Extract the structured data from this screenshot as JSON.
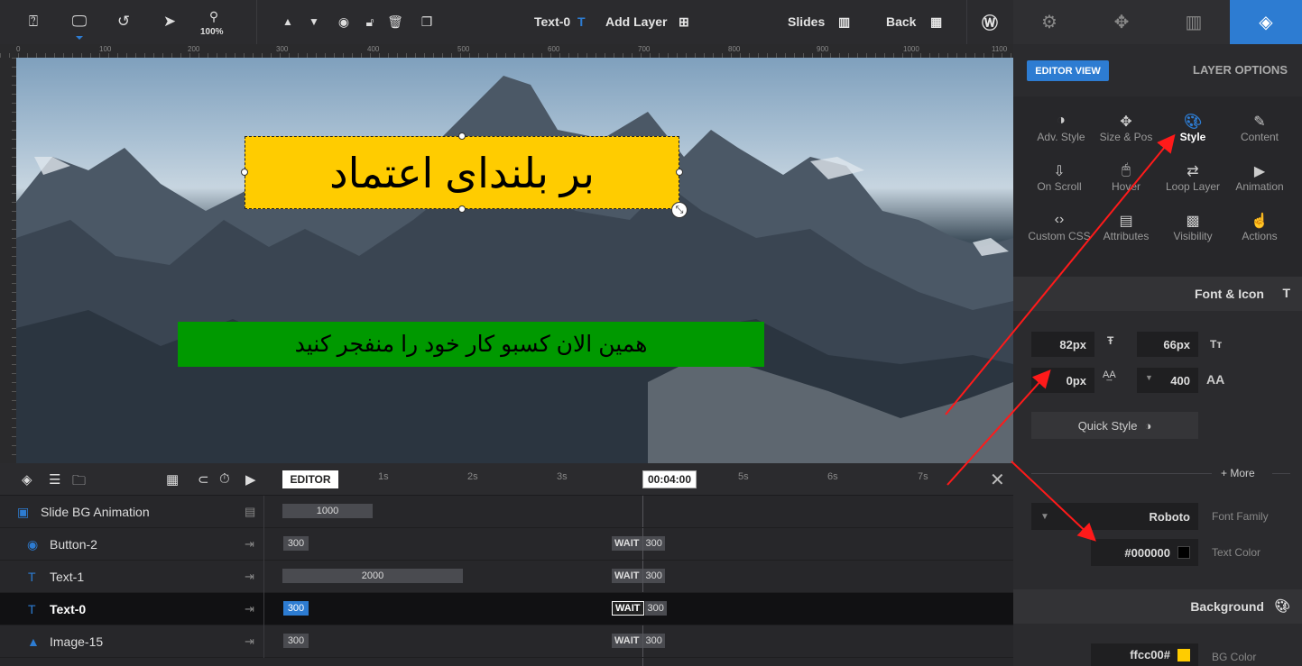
{
  "toolbar": {
    "zoom": "100%",
    "layer_name": "Text-0",
    "add_layer": "Add Layer",
    "slides": "Slides",
    "back": "Back"
  },
  "ruler": {
    "marks": [
      "0",
      "100",
      "200",
      "300",
      "400",
      "500",
      "600",
      "700",
      "800",
      "900",
      "1000",
      "1100"
    ]
  },
  "canvas": {
    "heading_text": "بر بلندای اعتماد",
    "sub_text": "همین الان کسبو کار خود را منفجر کنید",
    "colors": {
      "heading_bg": "#ffcc00",
      "sub_bg": "#009900",
      "accent": "#2d7cd2"
    }
  },
  "timeline": {
    "editor": "EDITOR",
    "seconds": [
      "1s",
      "2s",
      "3s",
      "5s",
      "6s",
      "7s"
    ],
    "current_time": "00:04:00",
    "rows": [
      {
        "label": "Slide BG Animation",
        "icon": "image-icon",
        "bar": "1000",
        "wait": "",
        "wait_value": ""
      },
      {
        "label": "Button-2",
        "icon": "radio-icon",
        "bar": "300",
        "wait": "WAIT",
        "wait_value": "300"
      },
      {
        "label": "Text-1",
        "icon": "text-t-icon",
        "bar": "2000",
        "wait": "WAIT",
        "wait_value": "300"
      },
      {
        "label": "Text-0",
        "icon": "text-t-icon",
        "bar": "300",
        "wait": "WAIT",
        "wait_value": "300"
      },
      {
        "label": "Image-15",
        "icon": "mountain-icon",
        "bar": "300",
        "wait": "WAIT",
        "wait_value": "300"
      }
    ]
  },
  "panel": {
    "editor_view": "EDITOR VIEW",
    "layer_options": "LAYER OPTIONS",
    "subtabs": [
      {
        "label": "Adv. Style",
        "icon": "contrast-icon"
      },
      {
        "label": "Size & Pos",
        "icon": "move-icon"
      },
      {
        "label": "Style",
        "icon": "palette-icon"
      },
      {
        "label": "Content",
        "icon": "pencil-icon"
      },
      {
        "label": "On Scroll",
        "icon": "scroll-icon"
      },
      {
        "label": "Hover",
        "icon": "mouse-icon"
      },
      {
        "label": "Loop Layer",
        "icon": "loop-icon"
      },
      {
        "label": "Animation",
        "icon": "play-icon"
      },
      {
        "label": "Custom CSS",
        "icon": "code-icon"
      },
      {
        "label": "Attributes",
        "icon": "file-icon"
      },
      {
        "label": "Visibility",
        "icon": "visibility-icon"
      },
      {
        "label": "Actions",
        "icon": "hand-icon"
      }
    ],
    "font_section": "Font & Icon",
    "font_size": "82px",
    "line_height": "66px",
    "letter_spacing": "0px",
    "font_weight": "400",
    "quick_style": "Quick Style",
    "more": "+ More",
    "font_family": "Roboto",
    "font_family_label": "Font Family",
    "text_color": "#000000",
    "text_color_label": "Text Color",
    "background_section": "Background",
    "bg_color": "ffcc00#",
    "bg_color_label": "BG Color"
  }
}
